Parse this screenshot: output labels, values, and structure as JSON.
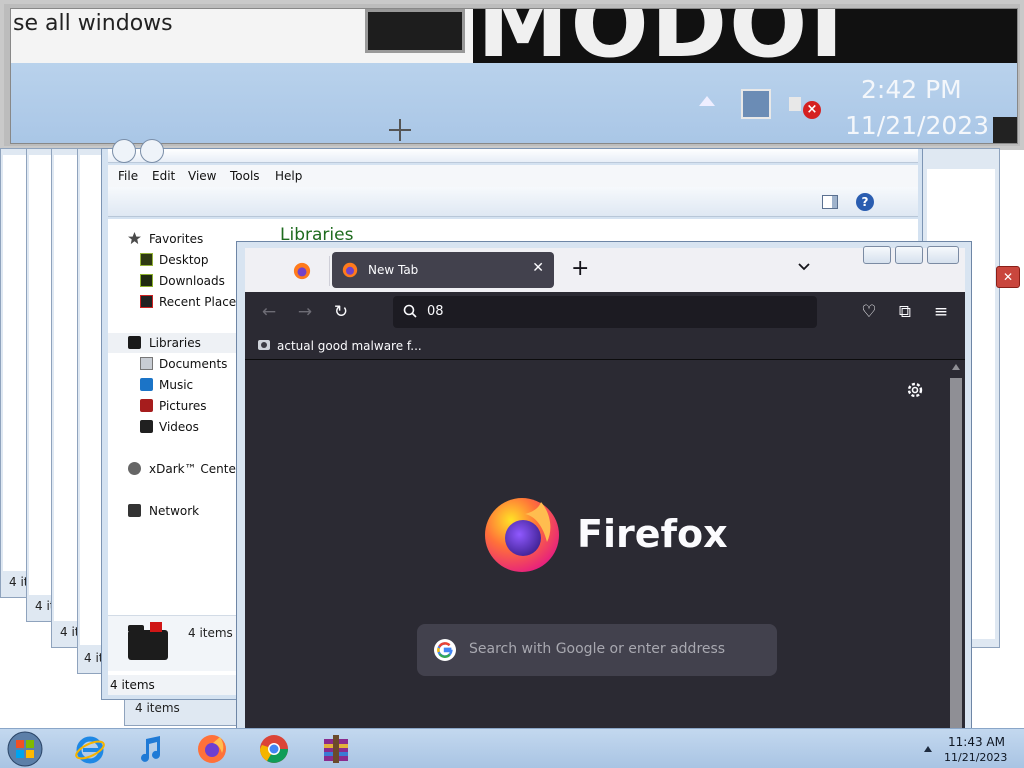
{
  "magnifier": {
    "partial_text": "se all windows",
    "wallpaper_text": "MODOI",
    "time": "2:42 PM",
    "date": "11/21/2023"
  },
  "background_windows": {
    "items_counts": [
      "4 it",
      "4 it",
      "4 it",
      "4 it"
    ]
  },
  "explorer": {
    "menu": [
      "File",
      "Edit",
      "View",
      "Tools",
      "Help"
    ],
    "content_title": "Libraries",
    "nav": {
      "favorites": "Favorites",
      "desktop": "Desktop",
      "downloads": "Downloads",
      "recent_places": "Recent Places",
      "libraries": "Libraries",
      "documents": "Documents",
      "music": "Music",
      "pictures": "Pictures",
      "videos": "Videos",
      "xdark": "xDark™ Center",
      "network": "Network"
    },
    "details_count": "4 items",
    "status_count": "4 items",
    "status_count_back": "4 items"
  },
  "firefox": {
    "tab_title": "New Tab",
    "new_tab_symbol": "+",
    "url_value": "08",
    "bookmark": "actual good malware f...",
    "wordmark": "Firefox",
    "search_placeholder": "Search with Google or enter address",
    "colors": {
      "toolbar": "#2b2a33",
      "tab": "#42414d",
      "url": "#1c1b22"
    }
  },
  "taskbar": {
    "apps": [
      "internet-explorer-icon",
      "itunes-icon",
      "firefox-icon",
      "chrome-icon",
      "winrar-icon"
    ],
    "time": "11:43 AM",
    "date": "11/21/2023"
  }
}
